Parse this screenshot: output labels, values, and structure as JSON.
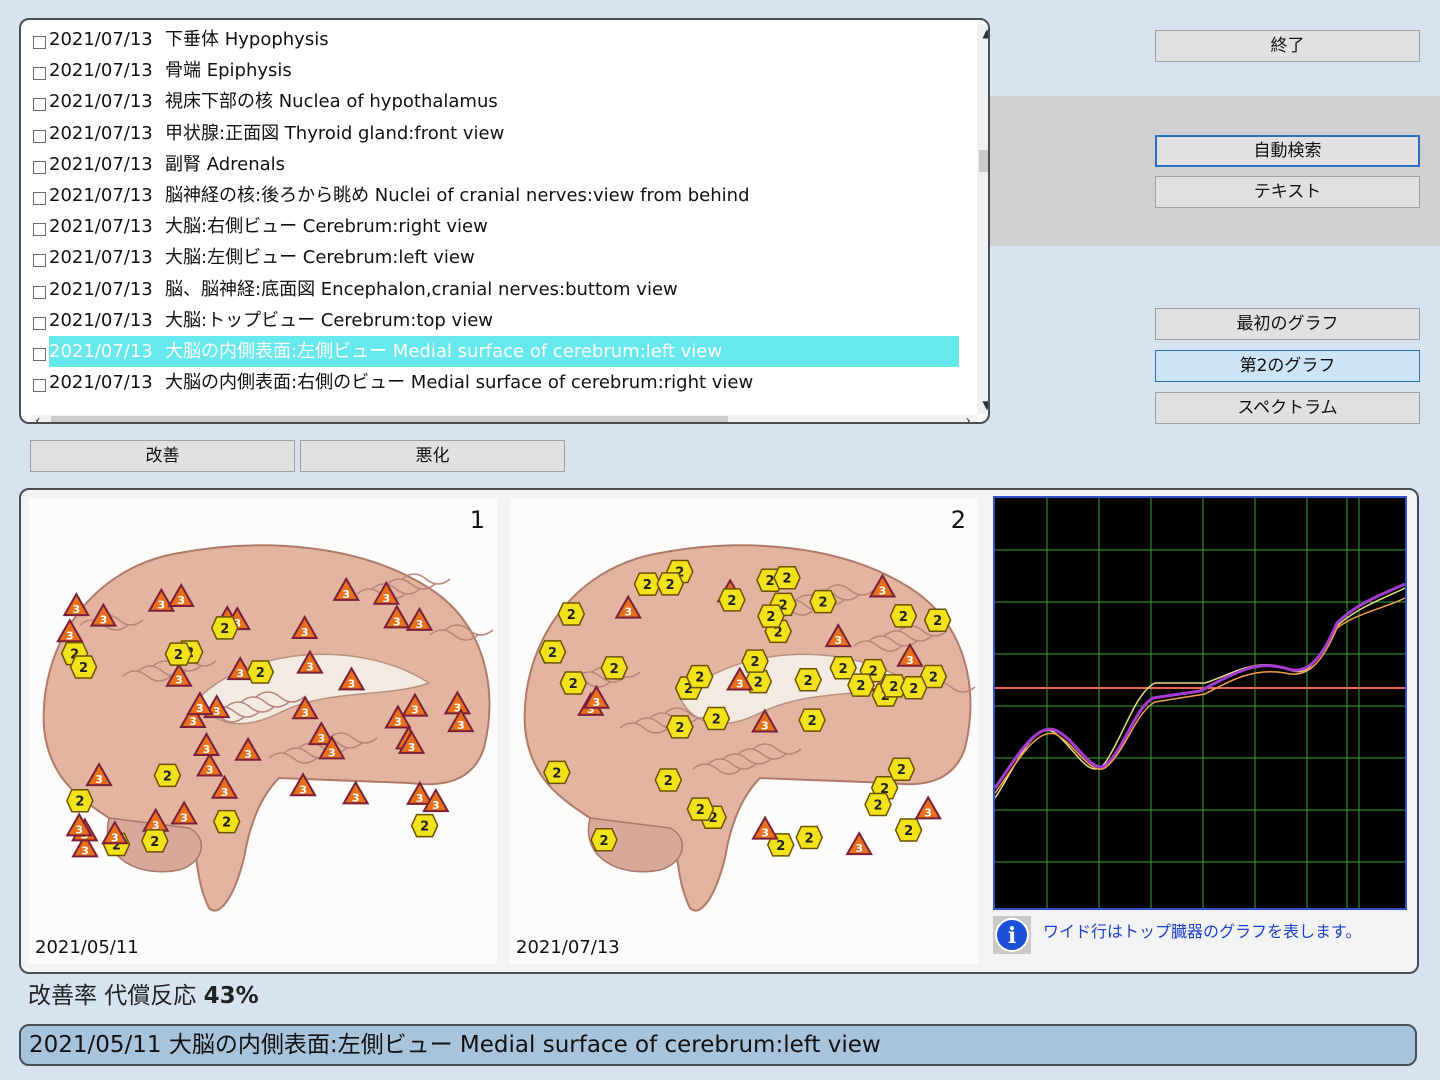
{
  "list": {
    "rows": [
      {
        "date": "2021/07/13",
        "text": "下垂体 Hypophysis"
      },
      {
        "date": "2021/07/13",
        "text": "骨端 Epiphysis"
      },
      {
        "date": "2021/07/13",
        "text": "視床下部の核 Nuclea of hypothalamus"
      },
      {
        "date": "2021/07/13",
        "text": "甲状腺:正面図 Thyroid gland:front view"
      },
      {
        "date": "2021/07/13",
        "text": "副腎 Adrenals"
      },
      {
        "date": "2021/07/13",
        "text": "脳神経の核:後ろから眺め Nuclei of cranial nerves:view from behind"
      },
      {
        "date": "2021/07/13",
        "text": "大脳:右側ビュー Cerebrum:right view"
      },
      {
        "date": "2021/07/13",
        "text": "大脳:左側ビュー Cerebrum:left view"
      },
      {
        "date": "2021/07/13",
        "text": "脳、脳神経:底面図 Encephalon,cranial nerves:buttom view"
      },
      {
        "date": "2021/07/13",
        "text": "大脳:トップビュー Cerebrum:top view"
      },
      {
        "date": "2021/07/13",
        "text": "大脳の内側表面:左側ビュー Medial surface of cerebrum:left view",
        "selected": true
      },
      {
        "date": "2021/07/13",
        "text": "大脳の内側表面:右側のビュー Medial surface of cerebrum:right view"
      }
    ]
  },
  "buttons": {
    "exit": "終了",
    "auto_search": "自動検索",
    "text": "テキスト",
    "first_graph": "最初のグラフ",
    "second_graph": "第2のグラフ",
    "spectrum": "スペクトラム",
    "improve": "改善",
    "worsen": "悪化"
  },
  "images": {
    "left": {
      "number": "1",
      "date": "2021/05/11"
    },
    "right": {
      "number": "2",
      "date": "2021/07/13"
    }
  },
  "graph_info": "ワイド行はトップ臓器のグラフを表します。",
  "improvement": {
    "label": "改善率 代償反応",
    "value": "43%"
  },
  "status_bar": "2021/05/11 大脳の内側表面:左側ビュー Medial surface of cerebrum:left view",
  "colors": {
    "selection": "#66e8ec",
    "graph_bg": "#000000",
    "grid": "#2fa82f",
    "marker3": "#e8701a",
    "marker2": "#f2e21a"
  }
}
